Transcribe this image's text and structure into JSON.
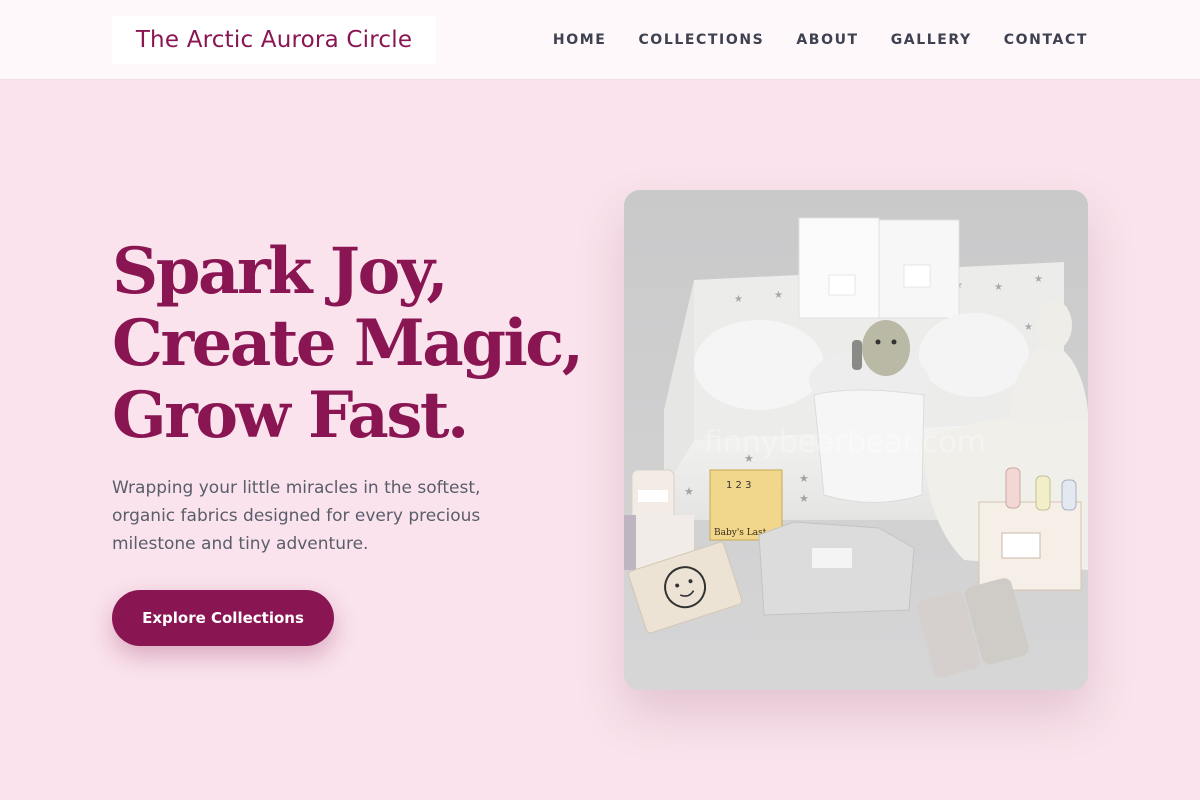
{
  "header": {
    "logo_text": "The Arctic Aurora Circle",
    "nav": [
      {
        "label": "HOME"
      },
      {
        "label": "COLLECTIONS"
      },
      {
        "label": "ABOUT"
      },
      {
        "label": "GALLERY"
      },
      {
        "label": "CONTACT"
      }
    ]
  },
  "hero": {
    "headline_lines": [
      "Spark Joy,",
      "Create Magic,",
      "Grow Fast."
    ],
    "subtext": "Wrapping your little miracles in the softest, organic fabrics designed for every precious milestone and tiny adventure.",
    "cta_label": "Explore Collections",
    "image_watermark": "finnybearbear.com",
    "image_book_title": "Baby's Last",
    "image_book_numbers": "1 2 3"
  },
  "colors": {
    "page_background": "#fae3ec",
    "header_background": "#fff8fa",
    "brand": "#8a1553",
    "nav_text": "#3e4150",
    "body_text": "#5a5d6b"
  }
}
